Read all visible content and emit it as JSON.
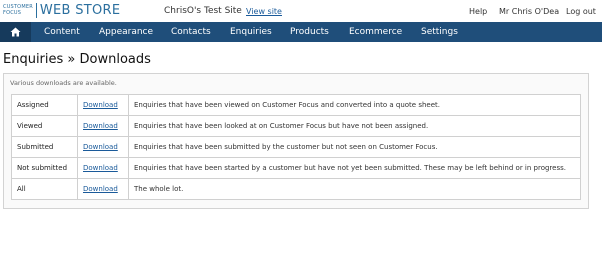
{
  "header": {
    "logo_small_1": "CUSTOMER",
    "logo_small_2": "FOCUS",
    "logo_big": "WEB STORE",
    "site_name": "ChrisO's Test Site",
    "view_site": "View site",
    "help": "Help",
    "user": "Mr Chris O'Dea",
    "logout": "Log out"
  },
  "nav": {
    "home_icon": "home-icon",
    "items": [
      "Content",
      "Appearance",
      "Contacts",
      "Enquiries",
      "Products",
      "Ecommerce",
      "Settings"
    ]
  },
  "main": {
    "title": "Enquiries » Downloads",
    "intro": "Various downloads are available.",
    "rows": [
      {
        "name": "Assigned",
        "link": "Download",
        "desc": "Enquiries that have been viewed on Customer Focus and converted into a quote sheet."
      },
      {
        "name": "Viewed",
        "link": "Download",
        "desc": "Enquiries that have been looked at on Customer Focus but have not been assigned."
      },
      {
        "name": "Submitted",
        "link": "Download",
        "desc": "Enquiries that have been submitted by the customer but not seen on Customer Focus."
      },
      {
        "name": "Not submitted",
        "link": "Download",
        "desc": "Enquiries that have been started by a customer but have not yet been submitted. These may be left behind or in progress."
      },
      {
        "name": "All",
        "link": "Download",
        "desc": "The whole lot."
      }
    ]
  },
  "colors": {
    "nav_bg": "#1f4e7a",
    "brand": "#2b6f9e",
    "link": "#1a5a9a"
  }
}
